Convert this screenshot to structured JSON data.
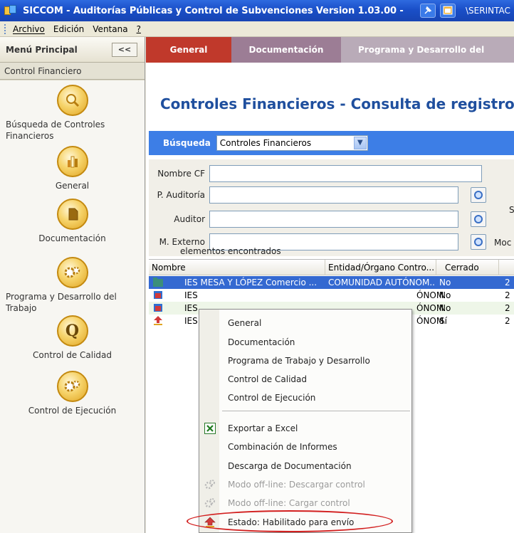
{
  "window": {
    "title": "SICCOM - Auditorías Públicas y Control de Subvenciones Version 1.03.00 -",
    "path_fragment": "\\SERINTAC"
  },
  "menubar": {
    "items": [
      "Archivo",
      "Edición",
      "Ventana",
      "?"
    ],
    "accelerators": [
      "A",
      "E",
      "n",
      "?"
    ]
  },
  "sidebar": {
    "header": "Menú Principal",
    "collapse_label": "<<",
    "section": "Control Financiero",
    "items": [
      {
        "label": "Búsqueda de Controles Financieros",
        "icon": "magnifier-icon"
      },
      {
        "label": "General",
        "icon": "chart-icon"
      },
      {
        "label": "Documentación",
        "icon": "document-icon"
      },
      {
        "label": "Programa y Desarrollo del Trabajo",
        "icon": "gears-icon"
      },
      {
        "label": "Control de Calidad",
        "icon": "q-letter-icon"
      },
      {
        "label": "Control de Ejecución",
        "icon": "gears-icon"
      }
    ]
  },
  "tabs": [
    {
      "label": "General",
      "active": true
    },
    {
      "label": "Documentación",
      "active": false
    },
    {
      "label": "Programa y Desarrollo del",
      "active": false
    }
  ],
  "main": {
    "title": "Controles Financieros - Consulta de registros",
    "search": {
      "label": "Búsqueda",
      "selected": "Controles Financieros"
    },
    "form": {
      "nombre_cf": "Nombre CF",
      "p_auditoria": "P. Auditoría",
      "auditor": "Auditor",
      "m_externo": "M. Externo",
      "cut_right_1": "S",
      "cut_right_2": "Moc"
    },
    "count_label": "elementos encontrados",
    "grid": {
      "columns": [
        "Nombre",
        "Entidad/Órgano Contro...",
        "Cerrado"
      ],
      "rows": [
        {
          "nombre": "IES MESA Y LÓPEZ Comercio ...",
          "entidad": "COMUNIDAD AUTÓNOM...",
          "cerrado": "No",
          "extra": "2"
        },
        {
          "nombre": "IES",
          "entidad": "ÓNOM...",
          "cerrado": "No",
          "extra": "2"
        },
        {
          "nombre": "IES",
          "entidad": "ÓNOM...",
          "cerrado": "No",
          "extra": "2"
        },
        {
          "nombre": "IES",
          "entidad": "ÓNOM...",
          "cerrado": "Sí",
          "extra": "2"
        }
      ]
    }
  },
  "context_menu": {
    "items": [
      {
        "label": "General",
        "enabled": true
      },
      {
        "label": "Documentación",
        "enabled": true
      },
      {
        "label": "Programa de Trabajo y Desarrollo",
        "enabled": true
      },
      {
        "label": "Control de Calidad",
        "enabled": true
      },
      {
        "label": "Control de Ejecución",
        "enabled": true
      },
      {
        "label": "Exportar a Excel",
        "enabled": true
      },
      {
        "label": "Combinación de Informes",
        "enabled": true
      },
      {
        "label": "Descarga de Documentación",
        "enabled": true
      },
      {
        "label": "Modo off-line: Descargar control",
        "enabled": false
      },
      {
        "label": "Modo off-line: Cargar control",
        "enabled": false
      },
      {
        "label": "Estado: Habilitado para envío",
        "enabled": true
      }
    ]
  },
  "colors": {
    "title_blue": "#1f4f9e",
    "tab_general": "#c0392b",
    "selection": "#3469d1",
    "annotation_red": "#d21f1f"
  }
}
